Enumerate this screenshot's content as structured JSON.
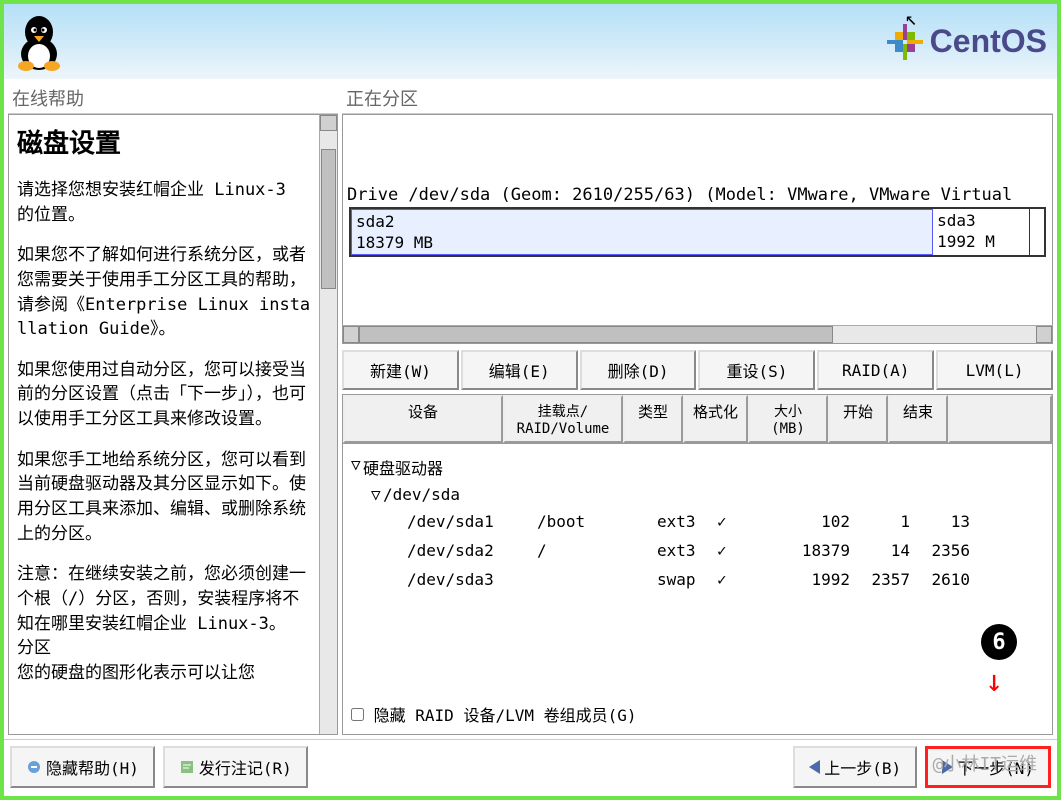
{
  "header": {
    "brand": "CentOS"
  },
  "help": {
    "title": "在线帮助",
    "h1": "磁盘设置",
    "p1": "请选择您想安装红帽企业 Linux-3 的位置。",
    "p2": "如果您不了解如何进行系统分区，或者您需要关于使用手工分区工具的帮助，请参阅《Enterprise Linux installation Guide》。",
    "p3": "如果您使用过自动分区，您可以接受当前的分区设置（点击「下一步」），也可以使用手工分区工具来修改设置。",
    "p4": "如果您手工地给系统分区，您可以看到当前硬盘驱动器及其分区显示如下。使用分区工具来添加、编辑、或删除系统上的分区。",
    "p5": "注意：在继续安装之前，您必须创建一个根（/）分区，否则，安装程序将不知在哪里安装红帽企业 Linux-3。\n分区\n您的硬盘的图形化表示可以让您"
  },
  "partition": {
    "title": "正在分区",
    "drive_line": "Drive /dev/sda (Geom: 2610/255/63) (Model: VMware, VMware Virtual",
    "segments": [
      {
        "name": "sda2",
        "size": "18379 MB",
        "width": "84%"
      },
      {
        "name": "sda3",
        "size": "1992 M",
        "width": "14%"
      }
    ],
    "toolbar": {
      "new": "新建(W)",
      "edit": "编辑(E)",
      "delete": "删除(D)",
      "reset": "重设(S)",
      "raid": "RAID(A)",
      "lvm": "LVM(L)"
    },
    "columns": {
      "device": "设备",
      "mount": "挂载点/\nRAID/Volume",
      "type": "类型",
      "format": "格式化",
      "size": "大小\n(MB)",
      "start": "开始",
      "end": "结束"
    },
    "root_label": "硬盘驱动器",
    "disk_label": "/dev/sda",
    "rows": [
      {
        "device": "/dev/sda1",
        "mount": "/boot",
        "type": "ext3",
        "fmt": true,
        "size": "102",
        "start": "1",
        "end": "13"
      },
      {
        "device": "/dev/sda2",
        "mount": "/",
        "type": "ext3",
        "fmt": true,
        "size": "18379",
        "start": "14",
        "end": "2356"
      },
      {
        "device": "/dev/sda3",
        "mount": "",
        "type": "swap",
        "fmt": true,
        "size": "1992",
        "start": "2357",
        "end": "2610"
      }
    ],
    "hide_raid": "隐藏 RAID 设备/LVM 卷组成员(G)"
  },
  "footer": {
    "hide_help": "隐藏帮助(H)",
    "release_notes": "发行注记(R)",
    "back": "上一步(B)",
    "next": "下一步(N)"
  },
  "badge": "6",
  "watermark": "@小林IT运维"
}
